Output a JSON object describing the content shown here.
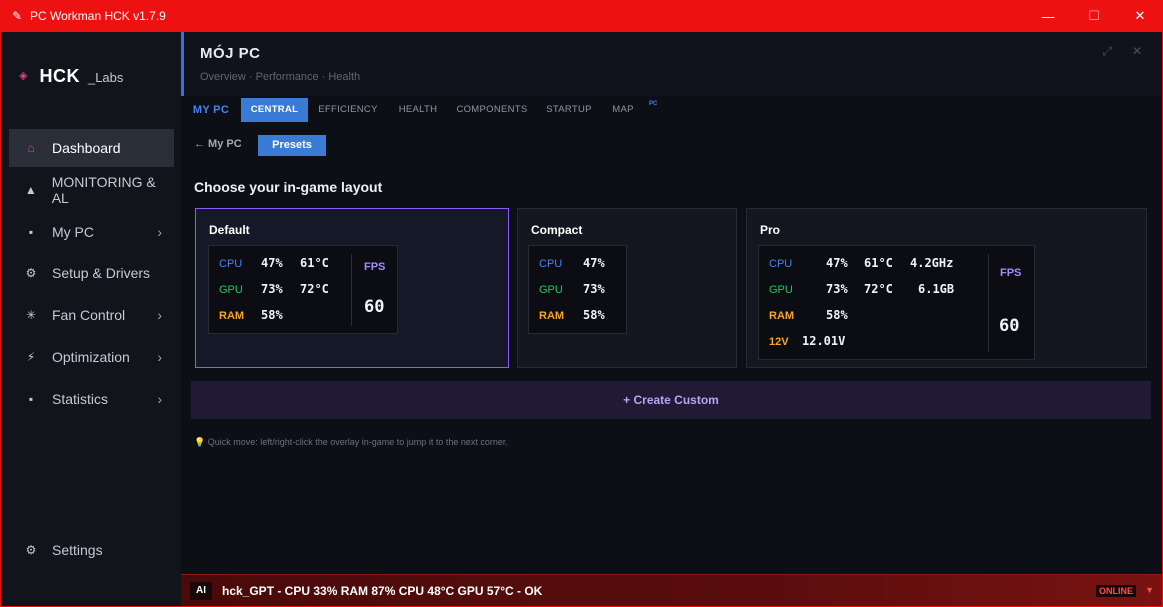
{
  "window": {
    "title": "PC Workman HCK  v1.7.9",
    "icon": "feather-icon",
    "controls": {
      "minimize": "—",
      "maximize": "☐",
      "close": "✕"
    }
  },
  "sidebar": {
    "brand": {
      "name": "HCK",
      "sub": "_Labs",
      "icon": "diamond-icon"
    },
    "items": [
      {
        "label": "Dashboard",
        "icon": "home-icon",
        "glyph": "⌂",
        "active": true,
        "chevron": ""
      },
      {
        "label": "MONITORING & AL",
        "icon": "warning-icon",
        "glyph": "▲",
        "active": false,
        "chevron": ""
      },
      {
        "label": "My PC",
        "icon": "pc-icon",
        "glyph": "▪",
        "active": false,
        "chevron": "›"
      },
      {
        "label": "Setup & Drivers",
        "icon": "gear-icon",
        "glyph": "⚙",
        "active": false,
        "chevron": ""
      },
      {
        "label": "Fan Control",
        "icon": "fan-icon",
        "glyph": "✳",
        "active": false,
        "chevron": "›"
      },
      {
        "label": "Optimization",
        "icon": "bolt-icon",
        "glyph": "⚡",
        "active": false,
        "chevron": "›"
      },
      {
        "label": "Statistics",
        "icon": "chart-icon",
        "glyph": "▪",
        "active": false,
        "chevron": "›"
      }
    ],
    "settings": {
      "label": "Settings",
      "icon": "gear-icon",
      "glyph": "⚙"
    }
  },
  "header": {
    "title": "MÓJ PC",
    "subtitle": "Overview · Performance · Health",
    "icons": {
      "expand": "⤢",
      "close": "✕"
    }
  },
  "tabs": {
    "main": "MY PC",
    "items": [
      "CENTRAL",
      "EFFICIENCY",
      "HEALTH",
      "COMPONENTS",
      "STARTUP",
      "MAP"
    ],
    "badge": "PC"
  },
  "subnav": {
    "back": "← My PC",
    "presets": "Presets"
  },
  "section_title": "Choose your in-game layout",
  "presets": {
    "default": {
      "title": "Default",
      "cpu_label": "CPU",
      "cpu_load": "47%",
      "cpu_temp": "61°C",
      "gpu_label": "GPU",
      "gpu_load": "73%",
      "gpu_temp": "72°C",
      "ram_label": "RAM",
      "ram_load": "58%",
      "fps_label": "FPS",
      "fps_value": "60"
    },
    "compact": {
      "title": "Compact",
      "cpu_label": "CPU",
      "cpu_load": "47%",
      "gpu_label": "GPU",
      "gpu_load": "73%",
      "ram_label": "RAM",
      "ram_load": "58%"
    },
    "pro": {
      "title": "Pro",
      "cpu_label": "CPU",
      "cpu_load": "47%",
      "cpu_temp": "61°C",
      "cpu_clock": "4.2GHz",
      "gpu_label": "GPU",
      "gpu_load": "73%",
      "gpu_temp": "72°C",
      "gpu_mem": "6.1GB",
      "ram_label": "RAM",
      "ram_load": "58%",
      "v12_label": "12V",
      "v12_value": "12.01V",
      "fps_label": "FPS",
      "fps_value": "60"
    }
  },
  "create_custom": "+  Create Custom",
  "hint": "Quick move: left/right-click the overlay in-game to jump it to the next corner.",
  "hint_icon": "bulb-icon",
  "statusbar": {
    "ai_badge": "AI",
    "text": "hck_GPT  -  CPU 33%  RAM 87%  CPU 48°C  GPU 57°C  - OK",
    "online": "ONLINE",
    "arrow": "▼"
  },
  "colors": {
    "titlebar": "#ee1111",
    "accent_blue": "#3a7bd5",
    "accent_purple": "#8b5cf6",
    "cpu": "#4a82f0",
    "gpu": "#22c55e",
    "ram": "#f5a623",
    "fps": "#a78bfa"
  }
}
